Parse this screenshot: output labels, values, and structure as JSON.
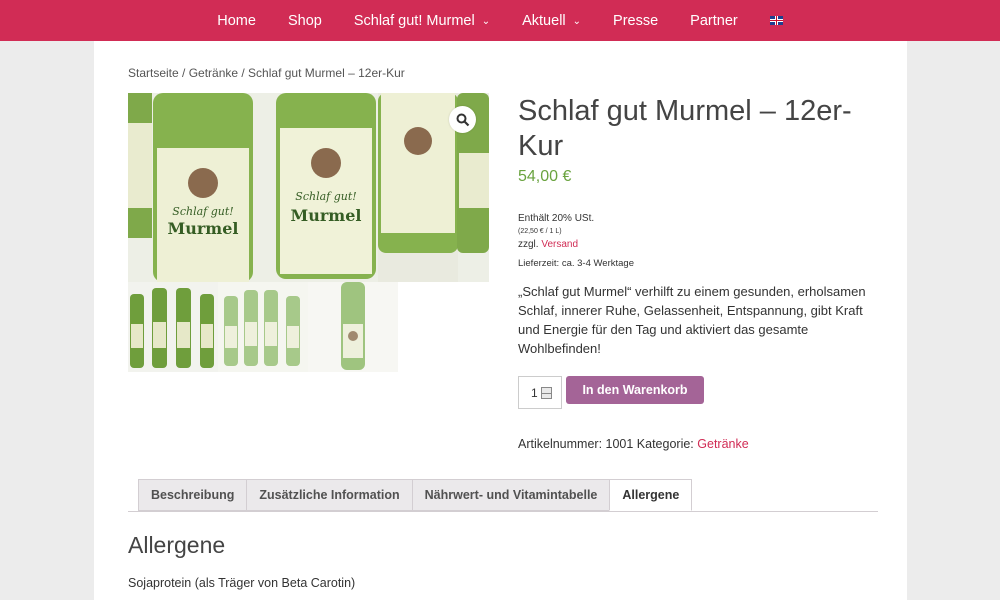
{
  "nav": {
    "items": [
      {
        "label": "Home",
        "dropdown": false
      },
      {
        "label": "Shop",
        "dropdown": false
      },
      {
        "label": "Schlaf gut! Murmel",
        "dropdown": true
      },
      {
        "label": "Aktuell",
        "dropdown": true
      },
      {
        "label": "Presse",
        "dropdown": false
      },
      {
        "label": "Partner",
        "dropdown": false
      }
    ],
    "language_icon": "uk-flag-icon"
  },
  "breadcrumb": "Startseite / Getränke / Schlaf gut Murmel – 12er-Kur",
  "gallery": {
    "label_line1": "Schlaf gut!",
    "label_line2": "Murmel",
    "zoom_icon": "magnifier-icon"
  },
  "product": {
    "title": "Schlaf gut Murmel – 12er-Kur",
    "price": "54,00 €",
    "tax_line": "Enthält 20% USt.",
    "unit_price": "(22,50 € / 1 L)",
    "shipping_prefix": "zzgl.",
    "shipping_link": "Versand",
    "delivery": "Lieferzeit: ca. 3-4 Werktage",
    "description": "„Schlaf gut Murmel“ verhilft zu einem gesunden, erholsamen Schlaf, innerer Ruhe, Gelassenheit, Entspannung, gibt Kraft und Energie für den Tag und aktiviert das gesamte Wohlbefinden!",
    "quantity": "1",
    "add_to_cart": "In den Warenkorb",
    "sku_text": "Artikelnummer: 1001 Kategorie:",
    "category": "Getränke"
  },
  "tabs": [
    {
      "label": "Beschreibung",
      "active": false
    },
    {
      "label": "Zusätzliche Information",
      "active": false
    },
    {
      "label": "Nährwert- und Vitamintabelle",
      "active": false
    },
    {
      "label": "Allergene",
      "active": true
    }
  ],
  "section": {
    "heading": "Allergene",
    "text": "Sojaprotein (als Träger von Beta Carotin)"
  },
  "colors": {
    "nav_bg": "#d12c55",
    "price": "#6aa33f",
    "cart_button": "#a46497",
    "link": "#d12c55"
  }
}
